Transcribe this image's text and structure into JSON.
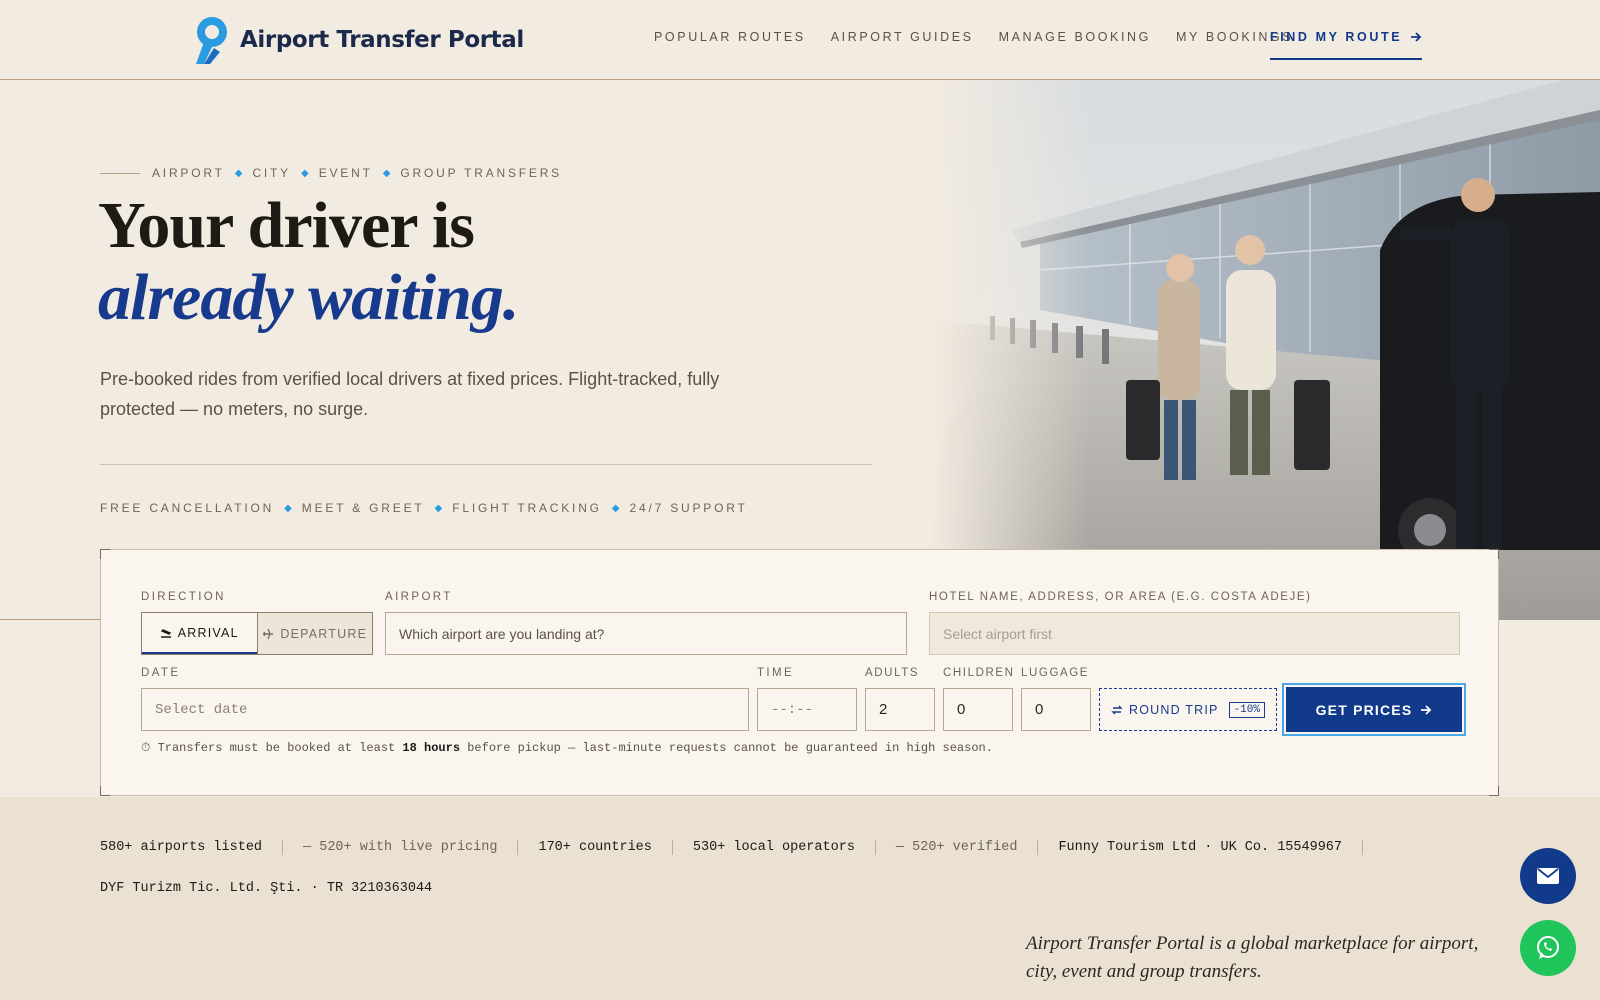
{
  "header": {
    "logo_text": "Airport Transfer Portal",
    "nav": [
      "POPULAR ROUTES",
      "AIRPORT GUIDES",
      "MANAGE BOOKING",
      "MY BOOKINGS"
    ],
    "cta_label": "FIND MY ROUTE",
    "cta_icon": "arrow-right-icon"
  },
  "hero": {
    "eyebrow": [
      "AIRPORT",
      "CITY",
      "EVENT",
      "GROUP TRANSFERS"
    ],
    "headline_line1": "Your driver is",
    "headline_line2": "already waiting.",
    "subtext": "Pre-booked rides from verified local drivers at fixed prices. Flight-tracked, fully protected — no meters, no surge.",
    "features": [
      "FREE CANCELLATION",
      "MEET & GREET",
      "FLIGHT TRACKING",
      "24/7 SUPPORT"
    ],
    "photo": "airport-arrival-photo"
  },
  "booking": {
    "direction_label": "DIRECTION",
    "arrival_label": "ARRIVAL",
    "departure_label": "DEPARTURE",
    "airport_label": "AIRPORT",
    "airport_placeholder": "Which airport are you landing at?",
    "hotel_label": "HOTEL NAME, ADDRESS, OR AREA (E.G. COSTA ADEJE)",
    "hotel_placeholder": "Select airport first",
    "date_label": "DATE",
    "date_placeholder": "Select date",
    "time_label": "TIME",
    "time_placeholder": "--:--",
    "adults_label": "ADULTS",
    "adults_value": "2",
    "children_label": "CHILDREN",
    "children_value": "0",
    "luggage_label": "LUGGAGE",
    "luggage_value": "0",
    "round_trip_label": "ROUND TRIP",
    "round_trip_badge": "-10%",
    "get_prices_label": "GET PRICES",
    "notice_prefix": "Transfers must be booked at least",
    "notice_bold": "18 hours",
    "notice_suffix": "before pickup — last-minute requests cannot be guaranteed in high season."
  },
  "stats": {
    "airports": "580+ airports listed",
    "live_pricing": "— 520+ with live pricing",
    "countries": "170+ countries",
    "operators": "530+ local operators",
    "verified": "— 520+ verified",
    "company_uk": "Funny Tourism Ltd · UK Co. 15549967",
    "company_tr": "DYF Turizm Tic. Ltd. Şti. · TR 3210363044"
  },
  "tagline": "Airport Transfer Portal is a global marketplace for airport, city, event and group transfers.",
  "colors": {
    "background": "#f2ebe1",
    "accent_navy": "#123a8a",
    "accent_blue": "#2a9be0",
    "whatsapp_green": "#1fc45a"
  },
  "floating": {
    "mail_icon": "mail-icon",
    "whatsapp_icon": "whatsapp-icon"
  }
}
